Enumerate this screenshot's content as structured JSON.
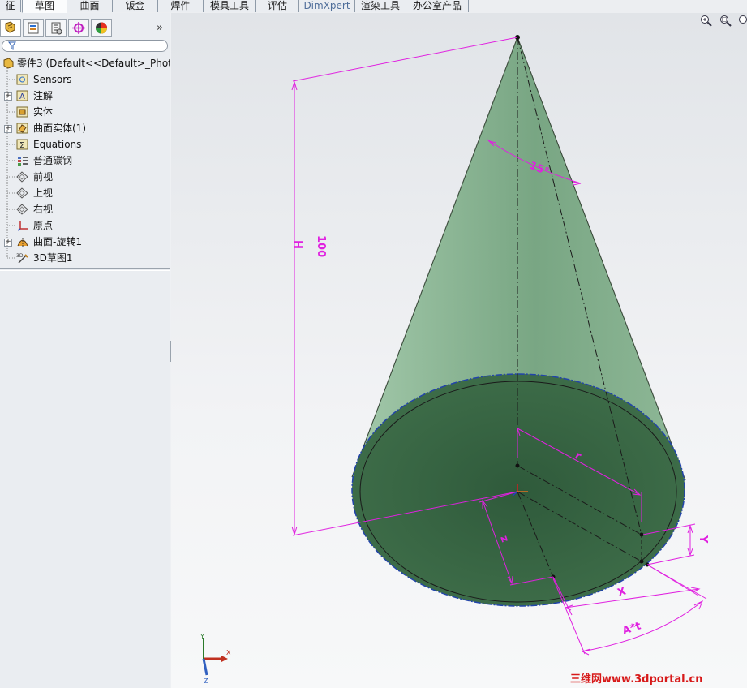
{
  "tabs": [
    {
      "label": "征",
      "active": false
    },
    {
      "label": "草图",
      "active": true
    },
    {
      "label": "曲面",
      "active": false
    },
    {
      "label": "钣金",
      "active": false
    },
    {
      "label": "焊件",
      "active": false
    },
    {
      "label": "模具工具",
      "active": false
    },
    {
      "label": "评估",
      "active": false
    },
    {
      "label": "DimXpert",
      "active": false
    },
    {
      "label": "渲染工具",
      "active": false
    },
    {
      "label": "办公室产品",
      "active": false
    }
  ],
  "panel_toolbar": {
    "buttons": [
      "feature-manager-icon",
      "property-manager-icon",
      "configuration-manager-icon",
      "dimxpert-manager-icon",
      "display-manager-icon"
    ],
    "overflow_label": "»"
  },
  "filter": {
    "icon": "filter-icon"
  },
  "tree": {
    "root": {
      "label": "零件3  (Default<<Default>_Photo",
      "icon": "part-icon"
    },
    "items": [
      {
        "label": "Sensors",
        "icon": "sensors-icon",
        "expandable": false
      },
      {
        "label": "注解",
        "icon": "annotations-icon",
        "expandable": true
      },
      {
        "label": "实体",
        "icon": "solid-bodies-icon",
        "expandable": false
      },
      {
        "label": "曲面实体(1)",
        "icon": "surface-bodies-icon",
        "expandable": true
      },
      {
        "label": "Equations",
        "icon": "equations-icon",
        "expandable": false
      },
      {
        "label": "普通碳钢",
        "icon": "material-icon",
        "expandable": false
      },
      {
        "label": "前视",
        "icon": "plane-icon",
        "expandable": false
      },
      {
        "label": "上视",
        "icon": "plane-icon",
        "expandable": false
      },
      {
        "label": "右视",
        "icon": "plane-icon",
        "expandable": false
      },
      {
        "label": "原点",
        "icon": "origin-icon",
        "expandable": false
      },
      {
        "label": "曲面-旋转1",
        "icon": "revolve-surface-icon",
        "expandable": true
      },
      {
        "label": "3D草图1",
        "icon": "3d-sketch-icon",
        "expandable": false
      }
    ]
  },
  "viewport": {
    "icons": [
      "zoom-to-fit-icon",
      "zoom-to-area-icon"
    ],
    "dimensions": {
      "height_value": "100",
      "height_name": "H",
      "angle": "15°",
      "radius": "r",
      "z": "z",
      "y": "Y",
      "x": "X",
      "arc": "A*t"
    },
    "triad": {
      "x": "X",
      "y": "Y",
      "z": "Z"
    },
    "colors": {
      "dimension": "#e020e0",
      "cone_fill": "#5f9a6c",
      "base_fill": "#2f5838",
      "edge_blue": "#2244aa"
    }
  },
  "watermark": "三维网www.3dportal.cn"
}
